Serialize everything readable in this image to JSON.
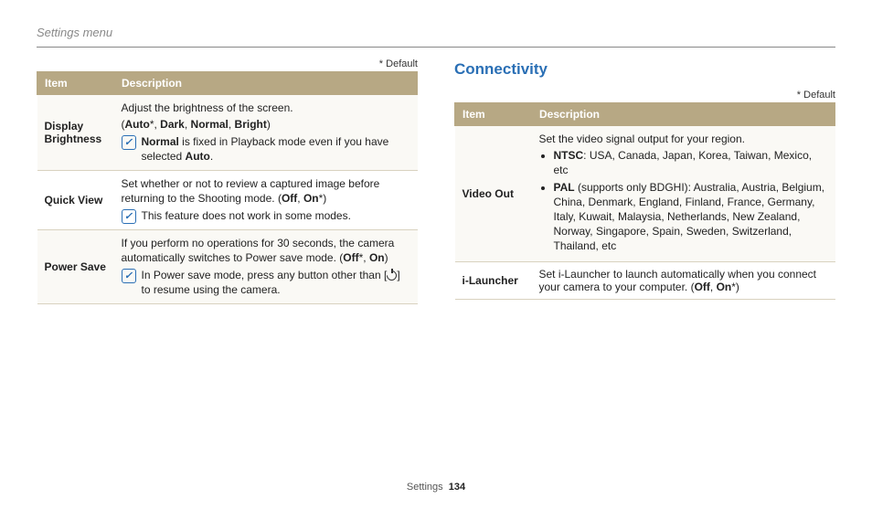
{
  "page_title": "Settings menu",
  "default_marker": "* Default",
  "footer": {
    "section": "Settings",
    "page": "134"
  },
  "left_table": {
    "headers": {
      "item": "Item",
      "description": "Description"
    },
    "rows": {
      "display": {
        "item": "Display Brightness",
        "line1": "Adjust the brightness of the screen.",
        "opts_prefix": "(",
        "opt_auto": "Auto",
        "sep": ", ",
        "opt_dark": "Dark",
        "opt_normal": "Normal",
        "opt_bright": "Bright",
        "opts_suffix": ")",
        "star": "*",
        "note_pre": "",
        "note_bold1": "Normal",
        "note_mid": " is fixed in Playback mode even if you have selected ",
        "note_bold2": "Auto",
        "note_post": "."
      },
      "quick": {
        "item": "Quick View",
        "line1_pre": "Set whether or not to review a captured image before returning to the Shooting mode. (",
        "opt_off": "Off",
        "sep": ", ",
        "opt_on": "On",
        "star": "*",
        "line1_post": ")",
        "note": "This feature does not work in some modes."
      },
      "power": {
        "item": "Power Save",
        "line1_pre": "If you perform no operations for 30 seconds, the camera automatically switches to Power save mode. (",
        "opt_off": "Off",
        "star": "*",
        "sep": ", ",
        "opt_on": "On",
        "line1_post": ")",
        "note_pre": "In Power save mode, press any button other than [",
        "note_post": "] to resume using the camera."
      }
    }
  },
  "right": {
    "heading": "Connectivity",
    "headers": {
      "item": "Item",
      "description": "Description"
    },
    "rows": {
      "video": {
        "item": "Video Out",
        "line1": "Set the video signal output for your region.",
        "ntsc_label": "NTSC",
        "ntsc_text": ": USA, Canada, Japan, Korea, Taiwan, Mexico, etc",
        "pal_label": "PAL",
        "pal_text": " (supports only BDGHI): Australia, Austria, Belgium, China, Denmark, England, Finland, France, Germany, Italy, Kuwait, Malaysia, Netherlands, New Zealand, Norway, Singapore, Spain, Sweden, Switzerland, Thailand, etc"
      },
      "ilauncher": {
        "item": "i-Launcher",
        "text_pre": "Set i-Launcher to launch automatically when you connect your camera to your computer. (",
        "opt_off": "Off",
        "sep": ", ",
        "opt_on": "On",
        "star": "*",
        "text_post": ")"
      }
    }
  }
}
